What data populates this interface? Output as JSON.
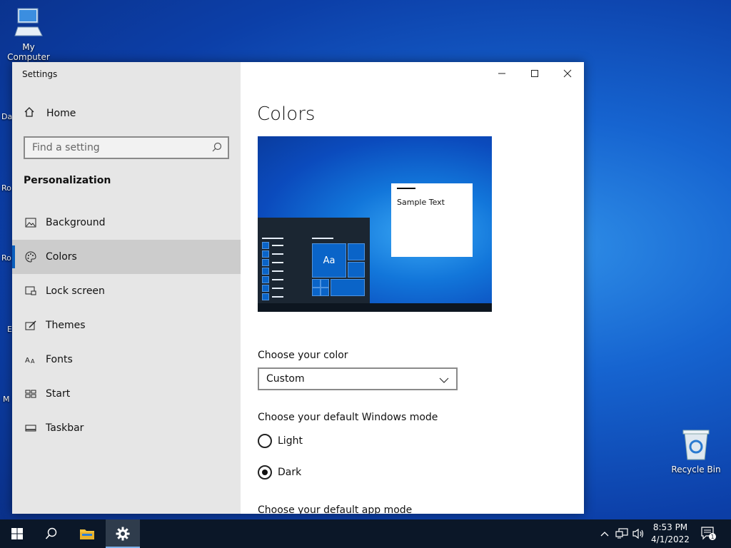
{
  "desktop": {
    "my_computer_label": "My Computer",
    "recycle_bin_label": "Recycle Bin",
    "peek_labels": [
      "Da",
      "Ro",
      "Ro",
      "E",
      "M"
    ]
  },
  "window": {
    "app_title": "Settings",
    "home_label": "Home",
    "search_placeholder": "Find a setting",
    "section_title": "Personalization",
    "nav_items": [
      {
        "label": "Background",
        "icon": "picture-icon"
      },
      {
        "label": "Colors",
        "icon": "palette-icon",
        "active": true
      },
      {
        "label": "Lock screen",
        "icon": "lock-screen-icon"
      },
      {
        "label": "Themes",
        "icon": "brush-icon"
      },
      {
        "label": "Fonts",
        "icon": "font-icon"
      },
      {
        "label": "Start",
        "icon": "start-icon"
      },
      {
        "label": "Taskbar",
        "icon": "taskbar-icon"
      }
    ],
    "controls": [
      "minimize",
      "maximize",
      "close"
    ]
  },
  "content": {
    "page_title": "Colors",
    "preview": {
      "sample_text": "Sample Text",
      "tile_text": "Aa"
    },
    "choose_color_label": "Choose your color",
    "choose_color_value": "Custom",
    "windows_mode_label": "Choose your default Windows mode",
    "windows_mode_options": [
      {
        "label": "Light",
        "selected": false
      },
      {
        "label": "Dark",
        "selected": true
      }
    ],
    "app_mode_label": "Choose your default app mode"
  },
  "taskbar": {
    "time": "8:53 PM",
    "date": "4/1/2022",
    "notification_count": "1",
    "accent": "#0b1728"
  }
}
